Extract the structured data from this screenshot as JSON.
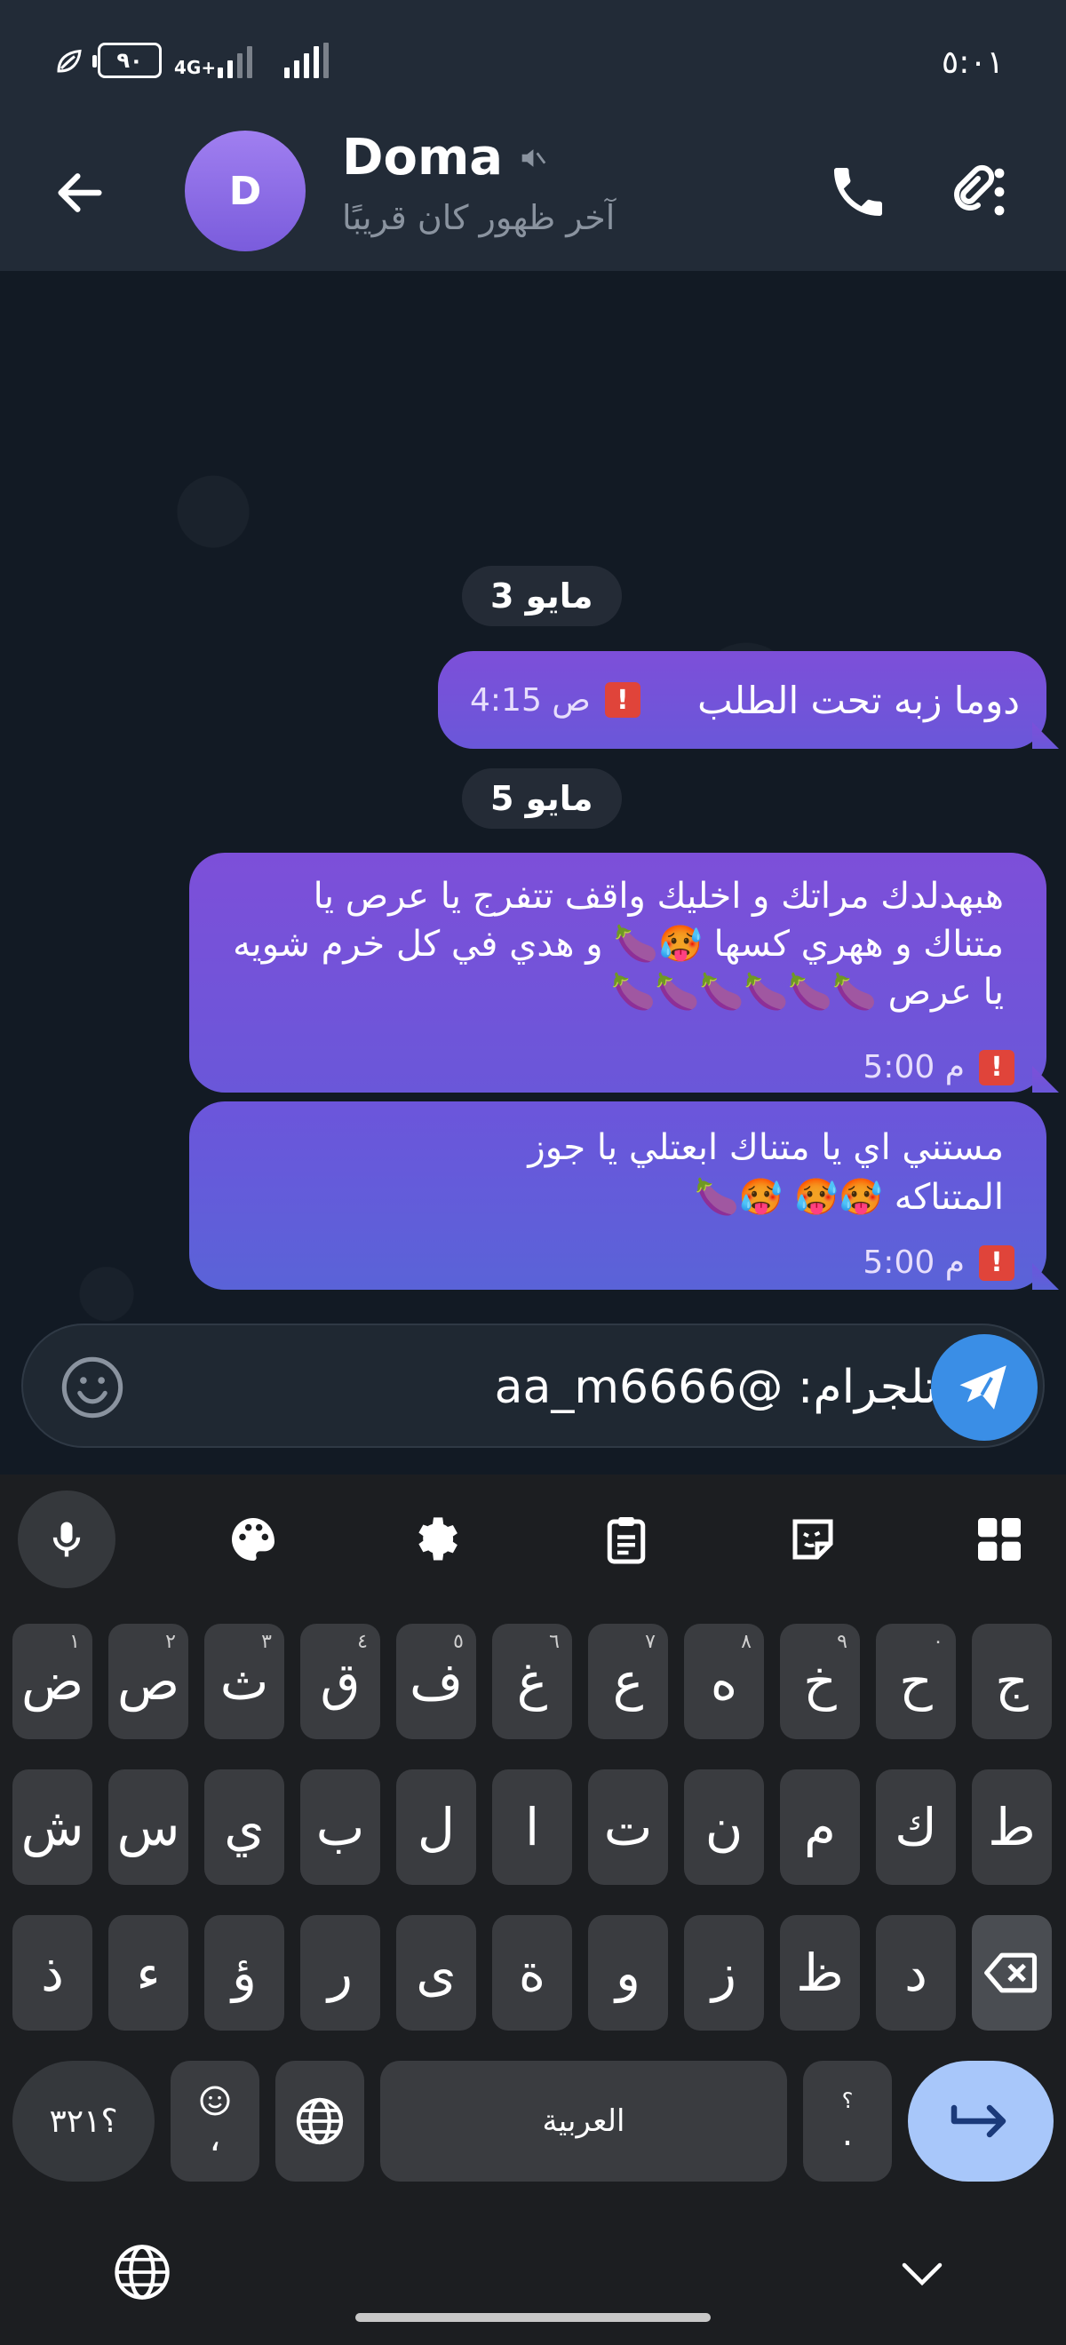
{
  "status_bar": {
    "battery": "٩٠",
    "network": "4G+",
    "time": "٥:٠١"
  },
  "header": {
    "contact_name": "Doma",
    "avatar_letter": "D",
    "last_seen": "آخر ظهور كان قريبًا",
    "muted_icon": "mute-icon",
    "call_icon": "phone-icon",
    "more_icon": "more-vertical-icon"
  },
  "chat": {
    "date_1": "3 مايو",
    "date_2": "5 مايو",
    "messages": [
      {
        "text": "دوما زبه تحت الطلب",
        "time": "4:15 ص",
        "status": "!"
      },
      {
        "text": "هبهدلدك مراتك و اخليك واقف تتفرج يا عرص يا متناك و ههري كسها 🥵🍆 و هدي في كل خرم شويه يا عرص 🍆🍆🍆🍆🍆🍆",
        "time": "5:00 م",
        "status": "!"
      },
      {
        "text": "مستني اي يا متناك ابعتلي يا جوز المتناكه 🥵🥵 🥵🍆",
        "time": "5:00 م",
        "status": "!"
      }
    ]
  },
  "composer": {
    "value": "تلجرام: @aa_m6666",
    "emoji_icon": "smiley-icon",
    "send_icon": "send-icon"
  },
  "keyboard": {
    "toolbar": [
      "mic-icon",
      "palette-icon",
      "settings-icon",
      "clipboard-icon",
      "sticker-icon",
      "apps-grid-icon"
    ],
    "row1": [
      {
        "k": "ض",
        "h": "١"
      },
      {
        "k": "ص",
        "h": "٢"
      },
      {
        "k": "ث",
        "h": "٣"
      },
      {
        "k": "ق",
        "h": "٤"
      },
      {
        "k": "ف",
        "h": "٥"
      },
      {
        "k": "غ",
        "h": "٦"
      },
      {
        "k": "ع",
        "h": "٧"
      },
      {
        "k": "ه",
        "h": "٨"
      },
      {
        "k": "خ",
        "h": "٩"
      },
      {
        "k": "ح",
        "h": "٠"
      },
      {
        "k": "ج",
        "h": ""
      }
    ],
    "row2": [
      "ش",
      "س",
      "ي",
      "ب",
      "ل",
      "ا",
      "ت",
      "ن",
      "م",
      "ك",
      "ط"
    ],
    "row3": [
      "ذ",
      "ء",
      "ؤ",
      "ر",
      "ى",
      "ة",
      "و",
      "ز",
      "ظ",
      "د"
    ],
    "symbols_key": "؟٣٢١",
    "comma_key": "،",
    "space_label": "العربية",
    "period_key": ".",
    "period_hint": "؟"
  }
}
